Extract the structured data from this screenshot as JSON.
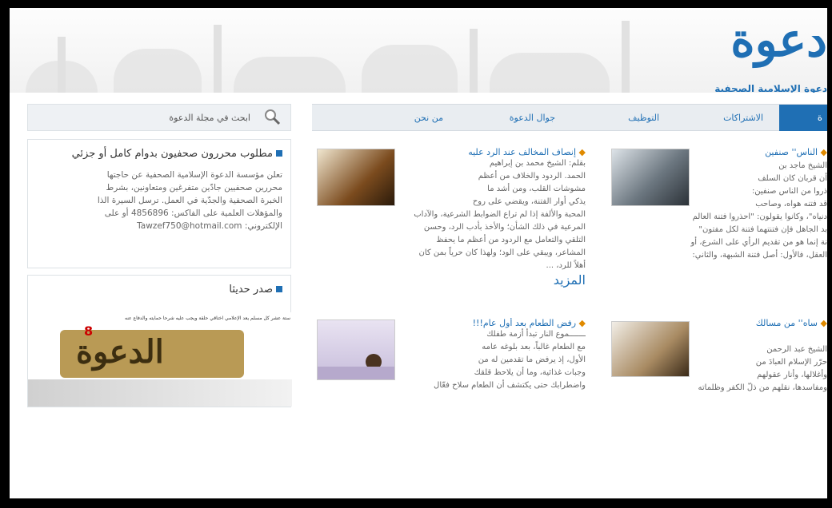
{
  "header": {
    "logo_word": "دعوة",
    "logo_subtitle": "دعوة الإسلامية الصحفية"
  },
  "nav": {
    "active_label": "ة",
    "items": [
      "الاشتراكات",
      "التوظيف",
      "جوال الدعوة",
      "من نحن"
    ]
  },
  "search": {
    "placeholder": "ابحث في مجلة الدعوة"
  },
  "sidebar": {
    "job_box": {
      "title": "مطلوب محررون صحفيون بدوام كامل أو جزئي",
      "text": "تعلن مؤسسة الدعوة الإسلامية الصحفية عن حاجتها\nمحررين صحفيين جادّين متفرغين ومتعاونين، بشرط\nالخبرة الصحفية والجدّية في العمل. ترسل السيرة الذا\nوالمؤهلات العلمية على الفاكس: 4856896 أو على\nالإلكتروني: Tawzef750@hotmail.com"
    },
    "issue_box": {
      "title": "صدر حديثا",
      "banner_text": "ستة عشر كل مسلم يعد الإعلامي اختاقي حلقة ويجب عليه شرحا حمايته والدفاع عنه",
      "magazine_name": "الدعوة",
      "issue_number": "8"
    }
  },
  "articles": {
    "a1": {
      "title": "إنصاف المخالف عند الرد عليه",
      "body": "بقلم: الشيخ محمد بن إبراهيم\nالحمد. الردود والخلاف من أعظم\nمشوشات القلب، ومن أشد ما\nيذكي أوار الفتنة، ويقضي على روح\nالمحبة والألفة إذا لم تراع الضوابط الشرعية، والآداب\nالمرعية في ذلك الشأن؛ والأخذ بأدب الرد، وحسن\nالتلقي والتعامل مع الردود من أعظم ما يحفظ\nالمشاعر، ويبقي على الود؛ ولهذا كان حرياً بمن كان\nأهلاً للرد، ...",
      "more": "المزيد"
    },
    "a2": {
      "title": "الناس'' صنفين",
      "body": "الشيخ ماجد بن\nأن قربان كان السلف\nذروا من الناس صنفين:\nقد فتنه هواه، وصاحب\nدنياه\"، وكانوا يقولون: \"احذروا فتنة العالم\nبد الجاهل فإن فتنتهما فتنة لكل مفتون\"\nنة إنما هو من تقديم الرأي على الشرع، أو\nالعقل، فالأول: أصل فتنة الشبهة، والثاني:"
    },
    "a3": {
      "title": "رفض الطعام بعد أول عام!!!",
      "body": "ـــــــموع النار تبدأ أزمة طفلك\nمع الطعام غالباً، بعد بلوغه عامه\nالأول، إذ يرفض ما تقدمين له من\nوجبات غذائية، وما أن يلاحظ قلقك\nواضطرابك حتى يكتشف أن الطعام سلاح فعّال"
    },
    "a4": {
      "title": "ساه'' من مسالك",
      "body": "الشيخ عبد الرحمن\nحرّر الإسلام العبادَ من\nوأغلالها، وأنار عقولهم\nومفاسدها، نقلهم من ذلّ الكفر وظلماته"
    }
  },
  "colors": {
    "accent": "#1f6fb4",
    "bullet": "#e08a00",
    "outer_border": "#000000"
  }
}
